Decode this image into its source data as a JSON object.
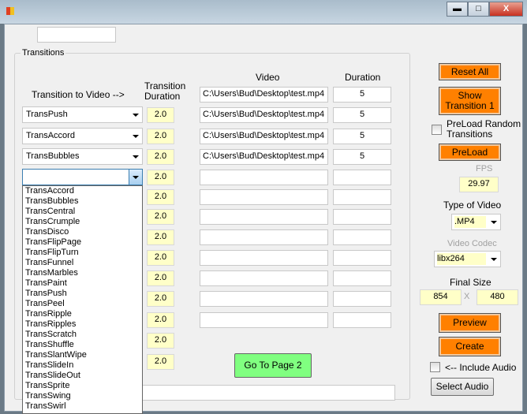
{
  "window": {
    "minimize": "▬",
    "maximize": "□",
    "close": "X"
  },
  "top_input": "",
  "group_title": "Transitions",
  "headers": {
    "transition_to_video": "Transition to Video -->",
    "transition_duration_1": "Transition",
    "transition_duration_2": "Duration",
    "video": "Video",
    "duration": "Duration"
  },
  "videos": [
    {
      "path": "C:\\Users\\Bud\\Desktop\\test.mp4",
      "duration": "5"
    },
    {
      "path": "C:\\Users\\Bud\\Desktop\\test.mp4",
      "duration": "5"
    },
    {
      "path": "C:\\Users\\Bud\\Desktop\\test.mp4",
      "duration": "5"
    },
    {
      "path": "C:\\Users\\Bud\\Desktop\\test.mp4",
      "duration": "5"
    },
    {
      "path": "",
      "duration": ""
    },
    {
      "path": "",
      "duration": ""
    },
    {
      "path": "",
      "duration": ""
    },
    {
      "path": "",
      "duration": ""
    },
    {
      "path": "",
      "duration": ""
    },
    {
      "path": "",
      "duration": ""
    },
    {
      "path": "",
      "duration": ""
    },
    {
      "path": "",
      "duration": ""
    }
  ],
  "transitions": [
    "TransPush",
    "TransAccord",
    "TransBubbles",
    ""
  ],
  "transition_durations": [
    "2.0",
    "2.0",
    "2.0",
    "2.0",
    "2.0",
    "2.0",
    "2.0",
    "2.0",
    "2.0",
    "2.0",
    "2.0",
    "2.0",
    "2.0"
  ],
  "dropdown_options": [
    "TransAccord",
    "TransBubbles",
    "TransCentral",
    "TransCrumple",
    "TransDisco",
    "TransFlipPage",
    "TransFlipTurn",
    "TransFunnel",
    "TransMarbles",
    "TransPaint",
    "TransPush",
    "TransPeel",
    "TransRipple",
    "TransRipples",
    "TransScratch",
    "TransShuffle",
    "TransSlantWipe",
    "TransSlideIn",
    "TransSlideOut",
    "TransSprite",
    "TransSwing",
    "TransSwirl"
  ],
  "go_page2": "Go To Page 2",
  "bottom_input": "",
  "right": {
    "reset_all": "Reset All",
    "show_transition_1": "Show",
    "show_transition_2": "Transition 1",
    "preload_random_1": "PreLoad Random",
    "preload_random_2": "Transitions",
    "preload": "PreLoad",
    "fps_label": "FPS",
    "fps": "29.97",
    "type_label": "Type of Video",
    "type": ".MP4",
    "codec_label": "Video Codec",
    "codec": "libx264",
    "final_size_label": "Final Size",
    "width": "854",
    "x": "X",
    "height": "480",
    "preview": "Preview",
    "create": "Create",
    "include_audio": "<-- Include Audio",
    "select_audio": "Select Audio"
  },
  "colors": {
    "orange": "#ff8000",
    "green": "#80ff80",
    "yellow": "#ffffc8"
  }
}
